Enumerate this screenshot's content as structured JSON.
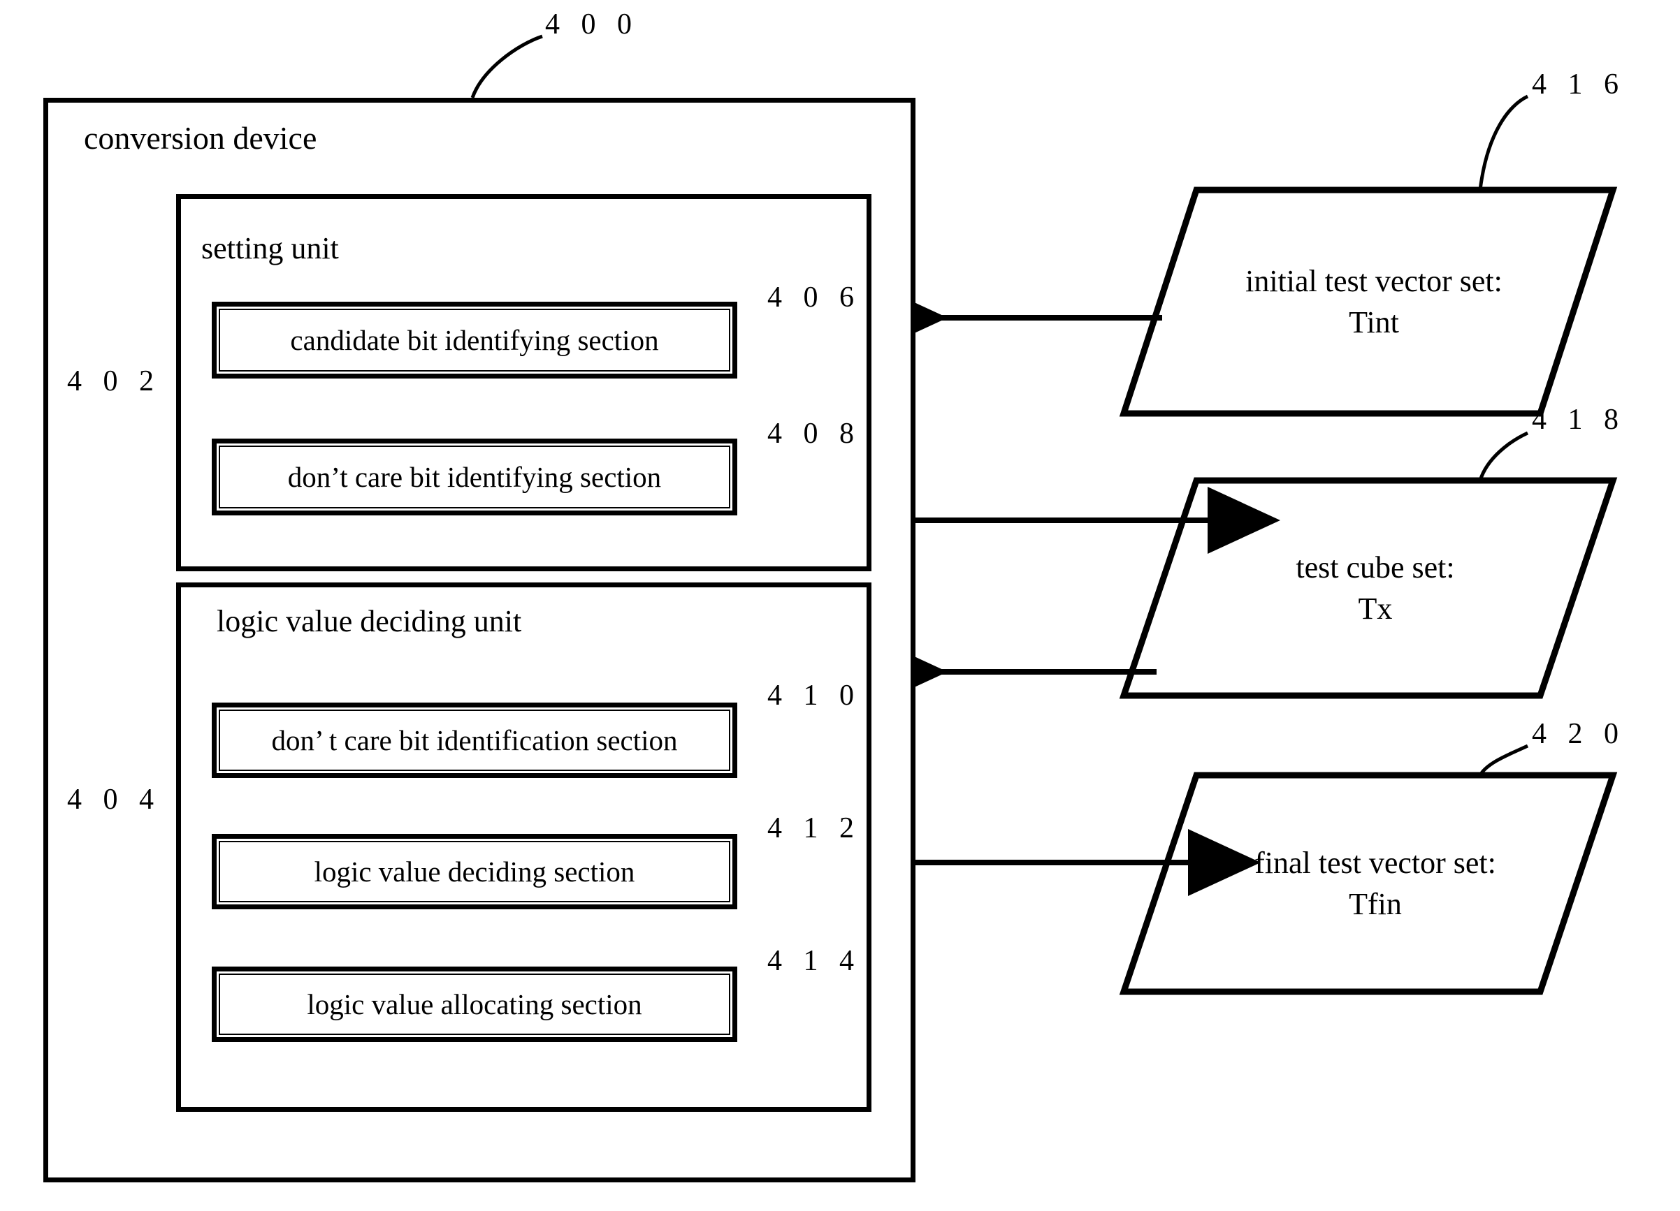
{
  "figure": {
    "device": {
      "ref": "4 0 0",
      "title": "conversion device"
    },
    "units": [
      {
        "ref": "4 0 2",
        "title": "setting unit",
        "sections": [
          {
            "ref": "4 0 6",
            "label": "candidate bit identifying section"
          },
          {
            "ref": "4 0 8",
            "label": "don’t care bit identifying section"
          }
        ]
      },
      {
        "ref": "4 0 4",
        "title": "logic value deciding unit",
        "sections": [
          {
            "ref": "4 1 0",
            "label": "don’ t care bit identification section"
          },
          {
            "ref": "4 1 2",
            "label": "logic value deciding section"
          },
          {
            "ref": "4 1 4",
            "label": "logic value allocating section"
          }
        ]
      }
    ],
    "stores": [
      {
        "ref": "4 1 6",
        "line1": "initial test vector set:",
        "line2": "Tint"
      },
      {
        "ref": "4 1 8",
        "line1": "test cube set:",
        "line2": "Tx"
      },
      {
        "ref": "4 2 0",
        "line1": "final test vector set:",
        "line2": "Tfin"
      }
    ],
    "flows": [
      {
        "name": "initial-test-vector-set-to-setting-unit",
        "direction": "left"
      },
      {
        "name": "setting-unit-to-test-cube-set",
        "direction": "right"
      },
      {
        "name": "test-cube-set-to-logic-value-deciding-unit",
        "direction": "left"
      },
      {
        "name": "logic-value-deciding-unit-to-final-test-vector-set",
        "direction": "right"
      }
    ],
    "colors": {
      "ink": "#000000",
      "paper": "#ffffff"
    }
  }
}
